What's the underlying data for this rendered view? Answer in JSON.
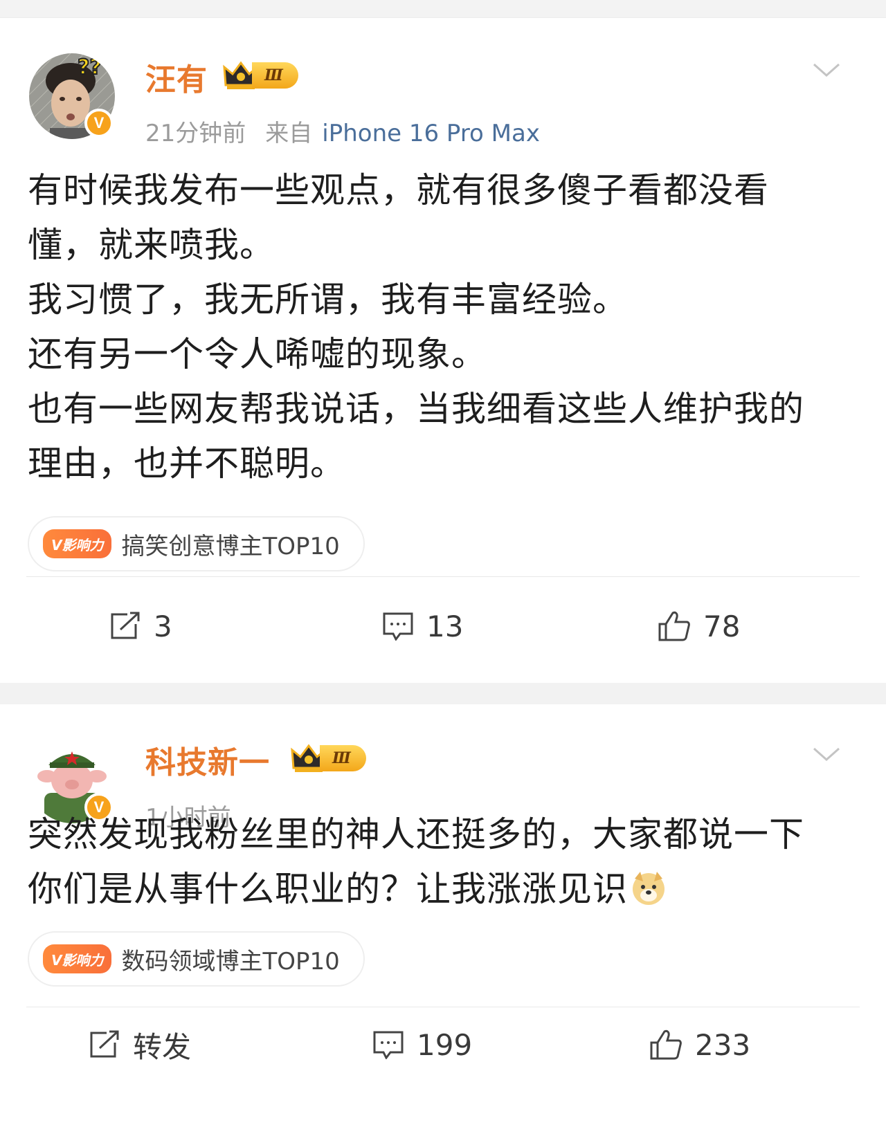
{
  "posts": [
    {
      "username": "汪有",
      "level_badge": "Ⅲ",
      "time": "21分钟前",
      "source_prefix": "来自",
      "device": "iPhone 16 Pro Max",
      "content_lines": [
        "有时候我发布一些观点，就有很多傻子看都没看",
        "懂，就来喷我。",
        "我习惯了，我无所谓，我有丰富经验。",
        "还有另一个令人唏嘘的现象。",
        "也有一些网友帮我说话，当我细看这些人维护我的",
        "理由，也并不聪明。"
      ],
      "influence_label": "V影响力",
      "tag": "搞笑创意博主TOP10",
      "repost": "3",
      "comments": "13",
      "likes": "78"
    },
    {
      "username": "科技新一",
      "level_badge": "Ⅲ",
      "time": "1小时前",
      "content_lines": [
        "突然发现我粉丝里的神人还挺多的，大家都说一下",
        "你们是从事什么职业的？让我涨涨见识"
      ],
      "influence_label": "V影响力",
      "tag": "数码领域博主TOP10",
      "repost": "转发",
      "comments": "199",
      "likes": "233"
    }
  ],
  "colors": {
    "username": "#e8792e",
    "device": "#4a6e9a",
    "meta": "#9b9b9b",
    "influence": "#f96f3a",
    "verified": "#f7a21b"
  },
  "icons": [
    "verified-v-icon",
    "crown-level-icon",
    "chevron-down-icon",
    "repost-icon",
    "comment-icon",
    "like-icon",
    "doge-emoji-icon"
  ]
}
